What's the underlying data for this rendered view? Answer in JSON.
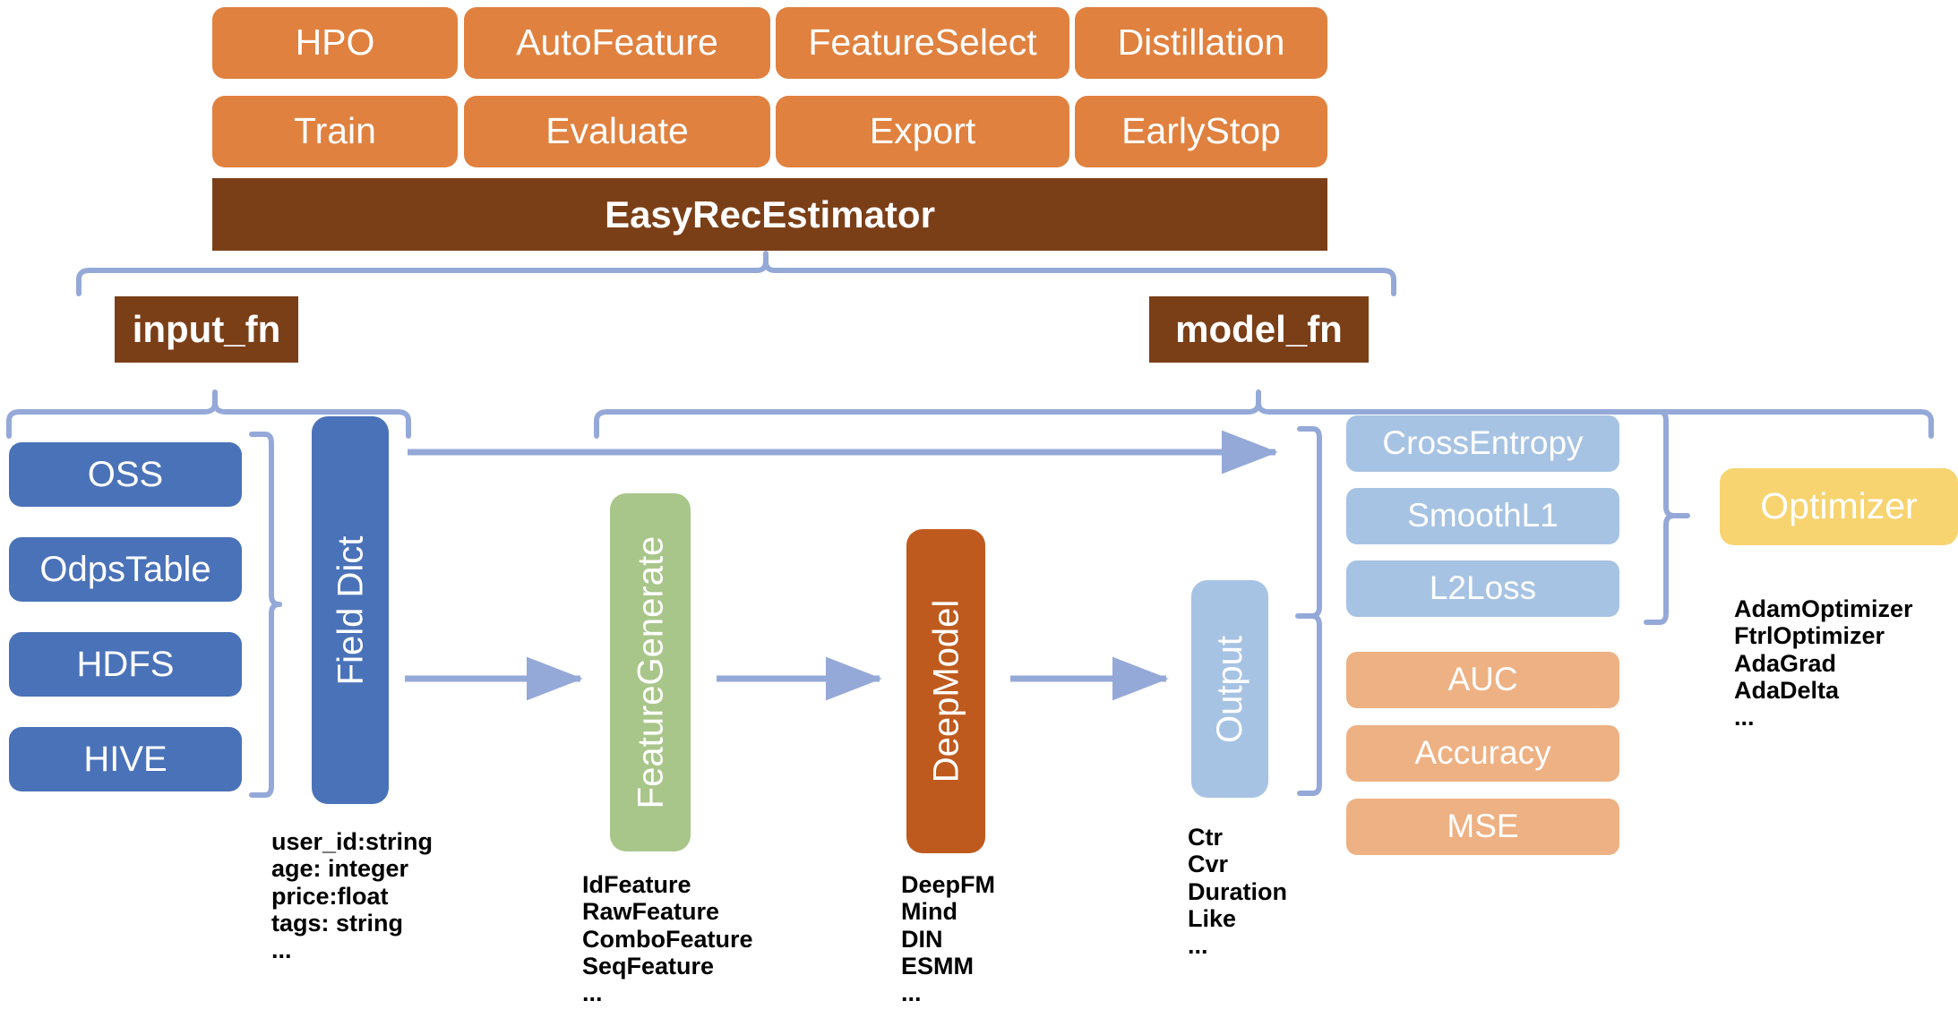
{
  "diagram": {
    "title_bar": {
      "label": "EasyRecEstimator"
    },
    "top_tasks": {
      "row1": [
        "HPO",
        "AutoFeature",
        "FeatureSelect",
        "Distillation"
      ],
      "row2": [
        "Train",
        "Evaluate",
        "Export",
        "EarlyStop"
      ]
    },
    "fn_labels": {
      "input_fn": "input_fn",
      "model_fn": "model_fn"
    },
    "data_sources": [
      "OSS",
      "OdpsTable",
      "HDFS",
      "HIVE"
    ],
    "field_dict": {
      "label": "Field Dict",
      "notes": [
        "user_id:string",
        "age: integer",
        "price:float",
        "tags: string",
        "..."
      ]
    },
    "feature_generate": {
      "label": "FeatureGenerate",
      "notes": [
        "IdFeature",
        "RawFeature",
        "ComboFeature",
        "SeqFeature",
        "..."
      ]
    },
    "deep_model": {
      "label": "DeepModel",
      "notes": [
        "DeepFM",
        "Mind",
        "DIN",
        "ESMM",
        "..."
      ]
    },
    "output": {
      "label": "Output",
      "notes": [
        "Ctr",
        "Cvr",
        "Duration",
        "Like",
        "..."
      ]
    },
    "losses": [
      "CrossEntropy",
      "SmoothL1",
      "L2Loss"
    ],
    "metrics": [
      "AUC",
      "Accuracy",
      "MSE"
    ],
    "optimizer": {
      "label": "Optimizer",
      "notes": [
        "AdamOptimizer",
        "FtrlOptimizer",
        "AdaGrad",
        "AdaDelta",
        "..."
      ]
    },
    "colors": {
      "task_orange": "#e0813f",
      "estimator_brown": "#7b3f18",
      "source_blue": "#4a72b8",
      "feature_green": "#a9c68a",
      "model_rust": "#bf5a1e",
      "output_blue": "#a7c3e3",
      "metric_orange": "#eeb183",
      "optimizer_yellow": "#f7d470",
      "connector_blue": "#95a9d8"
    }
  }
}
